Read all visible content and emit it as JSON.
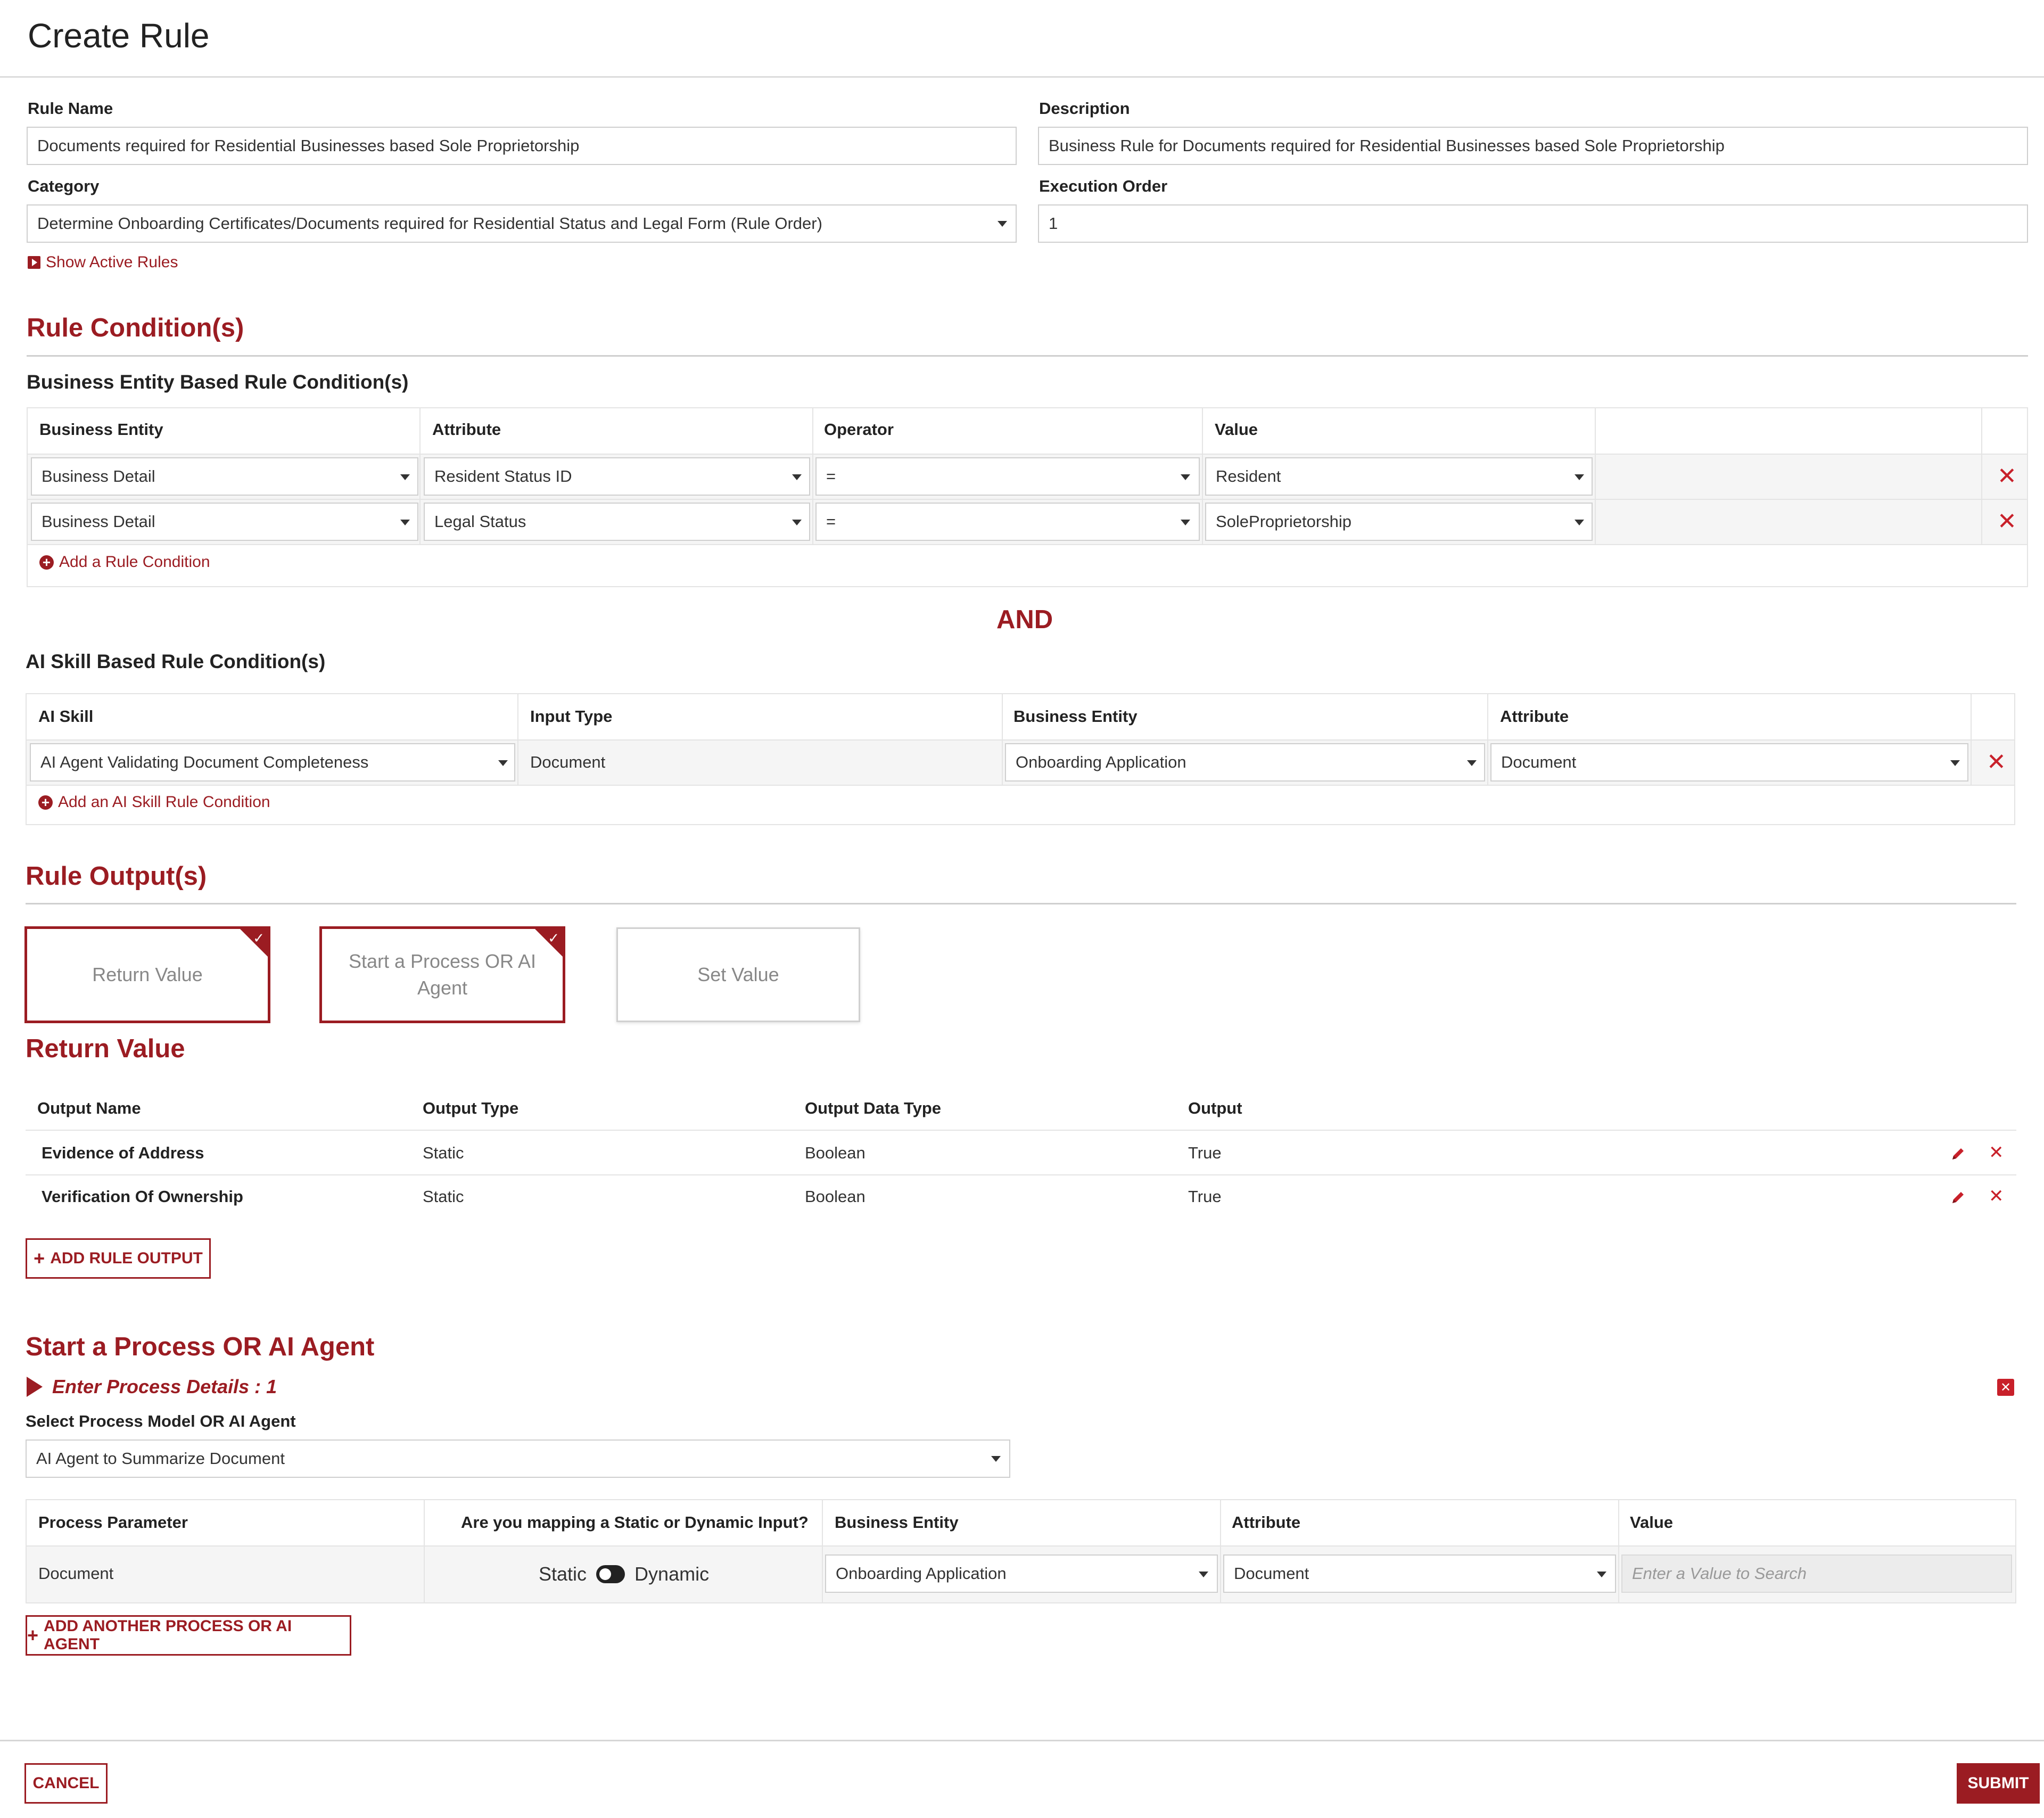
{
  "header": {
    "title": "Create Rule"
  },
  "form": {
    "rule_name_label": "Rule Name",
    "rule_name_value": "Documents required for Residential Businesses based Sole Proprietorship",
    "description_label": "Description",
    "description_value": "Business Rule for Documents required for Residential Businesses based Sole Proprietorship",
    "category_label": "Category",
    "category_value": "Determine Onboarding Certificates/Documents required for Residential Status and Legal Form (Rule Order)",
    "execution_order_label": "Execution Order",
    "execution_order_value": "1",
    "show_active_rules": "Show Active Rules"
  },
  "conditions": {
    "title": "Rule Condition(s)",
    "entity_subtitle": "Business Entity Based Rule Condition(s)",
    "entity_headers": [
      "Business Entity",
      "Attribute",
      "Operator",
      "Value"
    ],
    "entity_rows": [
      {
        "entity": "Business Detail",
        "attribute": "Resident Status ID",
        "operator": "=",
        "value": "Resident"
      },
      {
        "entity": "Business Detail",
        "attribute": "Legal Status",
        "operator": "=",
        "value": "SoleProprietorship"
      }
    ],
    "add_condition": "Add a Rule Condition",
    "and_label": "AND",
    "ai_subtitle": "AI Skill Based Rule Condition(s)",
    "ai_headers": [
      "AI Skill",
      "Input Type",
      "Business Entity",
      "Attribute"
    ],
    "ai_rows": [
      {
        "skill": "AI Agent Validating Document Completeness",
        "input_type": "Document",
        "entity": "Onboarding Application",
        "attribute": "Document"
      }
    ],
    "add_ai_condition": "Add an AI Skill Rule Condition"
  },
  "outputs": {
    "title": "Rule Output(s)",
    "cards": [
      "Return Value",
      "Start a Process OR AI Agent",
      "Set Value"
    ],
    "return_value_title": "Return Value",
    "headers": [
      "Output Name",
      "Output Type",
      "Output Data Type",
      "Output"
    ],
    "rows": [
      {
        "name": "Evidence of Address",
        "type": "Static",
        "data_type": "Boolean",
        "output": "True"
      },
      {
        "name": "Verification Of Ownership",
        "type": "Static",
        "data_type": "Boolean",
        "output": "True"
      }
    ],
    "add_output": "ADD RULE OUTPUT"
  },
  "process": {
    "title": "Start a Process OR AI Agent",
    "details_label": "Enter Process Details : 1",
    "select_label": "Select Process Model OR AI Agent",
    "select_value": "AI Agent to Summarize Document",
    "headers": [
      "Process Parameter",
      "Are you mapping a Static or Dynamic Input?",
      "Business Entity",
      "Attribute",
      "Value"
    ],
    "row": {
      "parameter": "Document",
      "static": "Static",
      "dynamic": "Dynamic",
      "entity": "Onboarding Application",
      "attribute": "Document",
      "value_placeholder": "Enter a Value to Search"
    },
    "add_another": "ADD ANOTHER PROCESS OR AI AGENT"
  },
  "footer": {
    "cancel": "CANCEL",
    "submit": "SUBMIT"
  },
  "colors": {
    "accent": "#9b1c22",
    "delete": "#c8202a"
  },
  "icons": [
    "play-square-icon",
    "plus-circle-icon",
    "close-icon",
    "chevron-down-icon",
    "check-icon",
    "pencil-icon",
    "plus-icon",
    "toggle-icon"
  ]
}
